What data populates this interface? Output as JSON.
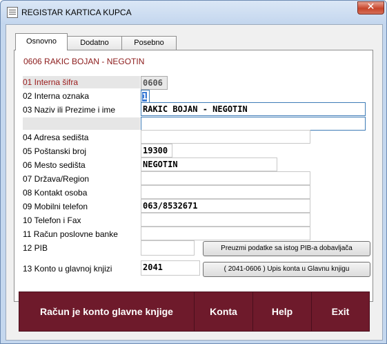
{
  "window": {
    "title": "REGISTAR KARTICA KUPCA",
    "close_symbol": "✕"
  },
  "tabs": [
    {
      "label": "Osnovno"
    },
    {
      "label": "Dodatno"
    },
    {
      "label": "Posebno"
    }
  ],
  "header": "0606 RAKIC BOJAN - NEGOTIN",
  "fields": [
    {
      "label": "01  Interna šifra",
      "value": "0606"
    },
    {
      "label": "02  Interna oznaka",
      "value": "1"
    },
    {
      "label": "03  Naziv ili Prezime i ime",
      "value": "RAKIC BOJAN - NEGOTIN",
      "value2": ""
    },
    {
      "label": "04  Adresa sedišta",
      "value": ""
    },
    {
      "label": "05  Poštanski broj",
      "value": "19300"
    },
    {
      "label": "06  Mesto sedišta",
      "value": "NEGOTIN"
    },
    {
      "label": "07  Država/Region",
      "value": ""
    },
    {
      "label": "08  Kontakt osoba",
      "value": ""
    },
    {
      "label": "09  Mobilni telefon",
      "value": "063/8532671"
    },
    {
      "label": "10  Telefon i Fax",
      "value": ""
    },
    {
      "label": "11  Račun poslovne banke",
      "value": ""
    },
    {
      "label": "12  PIB",
      "value": ""
    },
    {
      "label": "13  Konto u glavnoj knjizi",
      "value": "2041"
    }
  ],
  "buttons": {
    "preuzmi": "Preuzmi podatke sa istog PIB-a dobavljača",
    "upis_konta": "( 2041-0606 ) Upis konta u Glavnu knjigu",
    "racun": "Račun je konto glavne knjige",
    "konta": "Konta",
    "help": "Help",
    "exit": "Exit"
  }
}
